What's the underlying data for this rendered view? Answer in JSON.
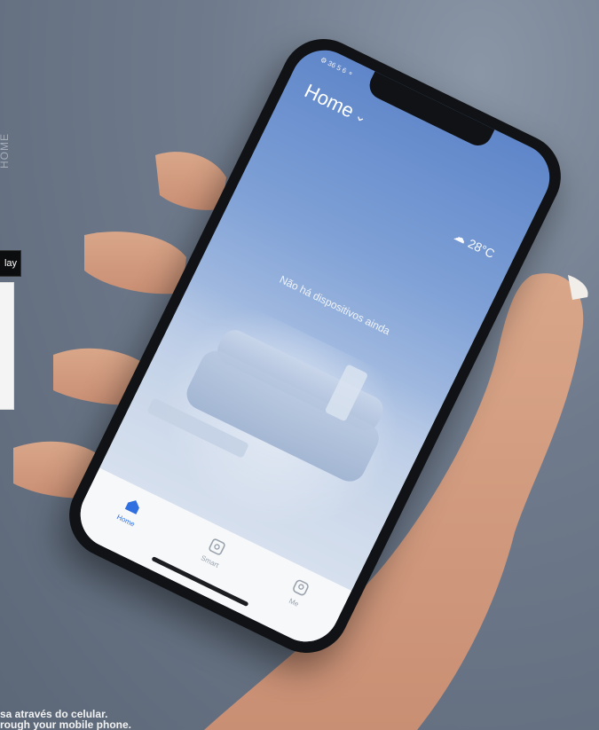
{
  "left_strip": {
    "vertical_text": "HOME"
  },
  "badges": {
    "dark_label": "lay"
  },
  "phone": {
    "status": {
      "left": "⚙ 36 5 6 ⚬",
      "right": ""
    },
    "home_title": "Home",
    "weather": {
      "label": "28°C"
    },
    "empty_message": "Não há dispositivos ainda",
    "tabs": [
      {
        "label": "Home"
      },
      {
        "label": "Smart"
      },
      {
        "label": "Me"
      }
    ]
  },
  "caption": {
    "line1": "sa através do celular.",
    "line2": "rough your mobile phone."
  },
  "colors": {
    "accent": "#2f6fe0",
    "background": "#6f7b8c"
  },
  "icons": {
    "home": "home-icon",
    "smart": "scene-icon",
    "me": "user-icon",
    "weather": "cloud-icon"
  }
}
